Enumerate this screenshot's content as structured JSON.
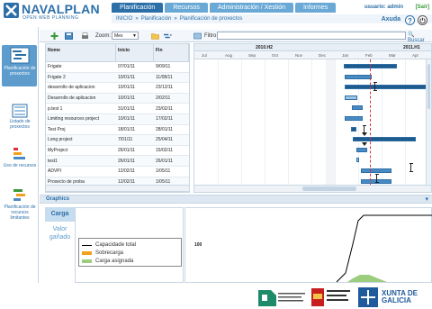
{
  "header": {
    "logo_title": "NAVALPLAN",
    "logo_subtitle": "OPEN WEB PLANNING",
    "tabs": [
      "Planificación",
      "Recursos",
      "Administración / Xestión",
      "Informes"
    ],
    "active_tab": "Planificación",
    "user_label": "usuario: admin",
    "logout_label": "[Saír]",
    "help_label": "Axuda",
    "breadcrumb": [
      "INICIO",
      "»",
      "Planificación",
      "»",
      "Planificación de proxectos"
    ]
  },
  "sidebar": {
    "items": [
      {
        "label": "Planificación de proxectos",
        "icon": "projects-planning-icon",
        "active": true
      },
      {
        "label": "Listado de proxectos",
        "icon": "projects-list-icon",
        "active": false
      },
      {
        "label": "Uso de recursos",
        "icon": "resources-load-icon",
        "active": false
      },
      {
        "label": "Planificación de recursos limitantes",
        "icon": "limiting-resources-icon",
        "active": false
      }
    ]
  },
  "toolbar": {
    "zoom_label": "Zoom:",
    "zoom_value": "Mes",
    "filter_label": "Filtro:",
    "filter_value": "",
    "search_label": "Buscar"
  },
  "table": {
    "headers": {
      "name": "Nome",
      "start": "Inicio",
      "end": "Fin"
    },
    "rows": [
      {
        "name": "Frigate",
        "start": "07/01/11",
        "end": "9/09/11"
      },
      {
        "name": "Frigate 2",
        "start": "10/01/11",
        "end": "11/08/11"
      },
      {
        "name": "desarrollo de aplicacion",
        "start": "10/01/11",
        "end": "23/12/11"
      },
      {
        "name": "Desarrollo de aplicacion",
        "start": "10/01/11",
        "end": "2/02/11"
      },
      {
        "name": "p.test 1",
        "start": "31/01/11",
        "end": "23/02/11"
      },
      {
        "name": "Limiting resources project",
        "start": "10/01/11",
        "end": "17/02/11"
      },
      {
        "name": "Test Proj",
        "start": "18/01/11",
        "end": "28/01/11"
      },
      {
        "name": "Long project",
        "start": "7/01/11",
        "end": "25/04/11"
      },
      {
        "name": "MyProject",
        "start": "26/01/11",
        "end": "15/02/11"
      },
      {
        "name": "test1",
        "start": "26/01/11",
        "end": "26/01/11"
      },
      {
        "name": "ADVPI",
        "start": "12/02/11",
        "end": "1/05/11"
      },
      {
        "name": "Proxecto de proba",
        "start": "12/02/11",
        "end": "1/05/11"
      }
    ]
  },
  "gantt": {
    "years": [
      "2010.H2",
      "2011.H1"
    ],
    "months": [
      "Jul",
      "Aug",
      "Sep",
      "Oct",
      "Nov",
      "Dec",
      "Jan",
      "Feb",
      "Mar",
      "Apr"
    ]
  },
  "graphics": {
    "title": "Graphics",
    "tabs": [
      "Carga",
      "Valor gañado"
    ],
    "active_tab": "Carga",
    "legend": [
      {
        "label": "Capacidade total",
        "color": "#000000"
      },
      {
        "label": "Sobrecarga",
        "color": "#f3a11c"
      },
      {
        "label": "Carga asignada",
        "color": "#9ccc7e"
      }
    ],
    "y_axis_value": "100"
  },
  "footer": {
    "logos": [
      "ministerio-logo",
      "gobierno-espana-logo",
      "xunta-de-galicia-logo"
    ],
    "xunta_text": "XUNTA DE GALICIA"
  }
}
